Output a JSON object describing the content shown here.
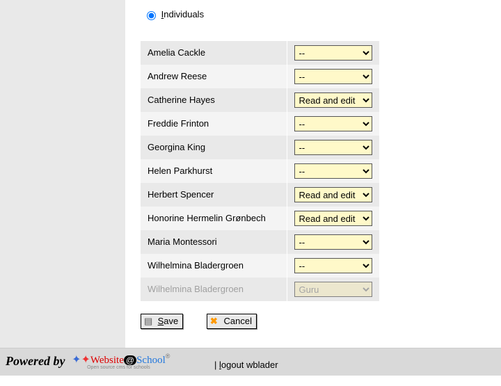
{
  "radio": {
    "label_pre": "I",
    "label_rest": "ndividuals",
    "checked": true
  },
  "options": {
    "none": "--",
    "read_edit": "Read and edit",
    "guru": "Guru"
  },
  "users": [
    {
      "name": "Amelia Cackle",
      "value": "none",
      "disabled": false,
      "row": "odd"
    },
    {
      "name": "Andrew Reese",
      "value": "none",
      "disabled": false,
      "row": "even"
    },
    {
      "name": "Catherine Hayes",
      "value": "read_edit",
      "disabled": false,
      "row": "odd"
    },
    {
      "name": "Freddie Frinton",
      "value": "none",
      "disabled": false,
      "row": "even"
    },
    {
      "name": "Georgina King",
      "value": "none",
      "disabled": false,
      "row": "odd"
    },
    {
      "name": "Helen Parkhurst",
      "value": "none",
      "disabled": false,
      "row": "even"
    },
    {
      "name": "Herbert Spencer",
      "value": "read_edit",
      "disabled": false,
      "row": "odd"
    },
    {
      "name": "Honorine Hermelin Grønbech",
      "value": "read_edit",
      "disabled": false,
      "row": "even"
    },
    {
      "name": "Maria Montessori",
      "value": "none",
      "disabled": false,
      "row": "odd"
    },
    {
      "name": "Wilhelmina Bladergroen",
      "value": "none",
      "disabled": false,
      "row": "even"
    },
    {
      "name": "Wilhelmina Bladergroen",
      "value": "guru",
      "disabled": true,
      "row": "odd"
    }
  ],
  "buttons": {
    "save_pre": "S",
    "save_rest": "ave",
    "cancel": "Cancel"
  },
  "footer": {
    "powered": "Powered by",
    "logo_website": "Website",
    "logo_at": "@",
    "logo_school": "School",
    "logo_tag": "Open source cms for schools",
    "sep": " | ",
    "logout_pre": "l",
    "logout_rest": "ogout wblader"
  }
}
